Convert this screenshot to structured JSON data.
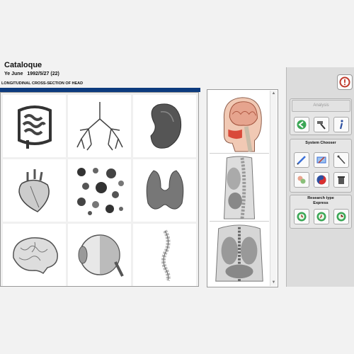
{
  "header": {
    "title": "Cataloque",
    "patient_name": "Ye June",
    "patient_dob": "1992/5/27",
    "patient_age": "(22)",
    "section": "LONGITUDINAL CROSS-SECTION OF HEAD"
  },
  "grid_items": [
    {
      "name": "intestines",
      "icon": "intestines-icon"
    },
    {
      "name": "lungs",
      "icon": "bronchial-tree-icon"
    },
    {
      "name": "kidney",
      "icon": "kidney-icon"
    },
    {
      "name": "heart",
      "icon": "heart-icon"
    },
    {
      "name": "cells",
      "icon": "cells-icon"
    },
    {
      "name": "thyroid",
      "icon": "thyroid-icon"
    },
    {
      "name": "brain",
      "icon": "brain-icon"
    },
    {
      "name": "eye",
      "icon": "eyeball-icon"
    },
    {
      "name": "spine",
      "icon": "spine-icon"
    }
  ],
  "strip_items": [
    {
      "name": "head-cross-section",
      "icon": "head-section-icon"
    },
    {
      "name": "torso-cross-section",
      "icon": "torso-section-icon"
    },
    {
      "name": "chest-cross-section",
      "icon": "chest-section-icon"
    }
  ],
  "controls": {
    "analysis_label": "Analysis",
    "system_chooser_label": "System Chooser",
    "research_label_1": "Research type",
    "research_label_2": "Express",
    "accent": "#c0392b"
  }
}
